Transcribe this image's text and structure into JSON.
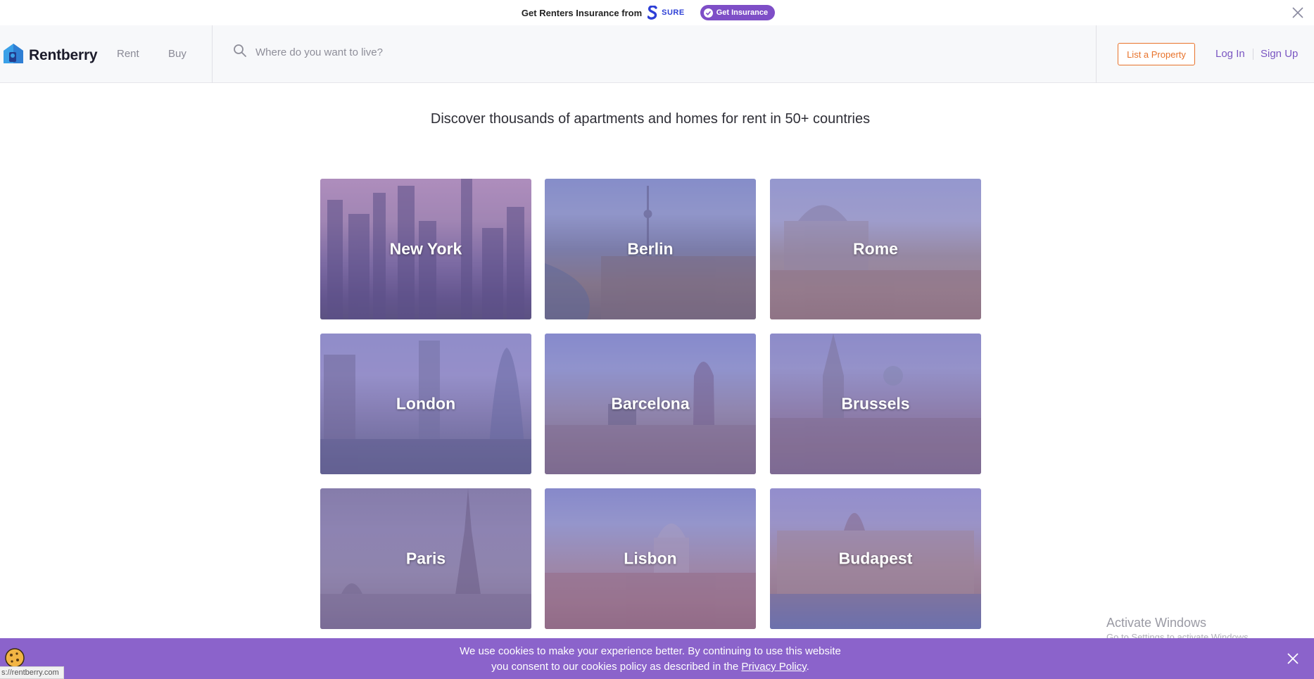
{
  "promo": {
    "text": "Get Renters Insurance from",
    "brand": "SURE",
    "button_label": "Get Insurance"
  },
  "header": {
    "logo_text": "Rentberry",
    "nav": [
      {
        "label": "Rent"
      },
      {
        "label": "Buy"
      }
    ],
    "search_placeholder": "Where do you want to live?",
    "list_property_label": "List a Property",
    "login_label": "Log In",
    "signup_label": "Sign Up"
  },
  "main": {
    "tagline": "Discover thousands of apartments and homes for rent in 50+ countries",
    "cities": [
      {
        "name": "New York"
      },
      {
        "name": "Berlin"
      },
      {
        "name": "Rome"
      },
      {
        "name": "London"
      },
      {
        "name": "Barcelona"
      },
      {
        "name": "Brussels"
      },
      {
        "name": "Paris"
      },
      {
        "name": "Lisbon"
      },
      {
        "name": "Budapest"
      }
    ]
  },
  "watermark": {
    "title": "Activate Windows",
    "subtitle": "Go to Settings to activate Windows."
  },
  "cookie": {
    "line1": "We use cookies to make your experience better. By continuing to use this website",
    "line2_prefix": "you consent to our cookies policy as described in the",
    "policy_link": "Privacy Policy",
    "line2_suffix": "."
  },
  "status_url": "s://rentberry.com",
  "colors": {
    "accent_purple": "#7e4ec7",
    "cookie_bar": "#8b63cb",
    "list_property_orange": "#e8722a",
    "link_purple": "#7a56c2"
  }
}
